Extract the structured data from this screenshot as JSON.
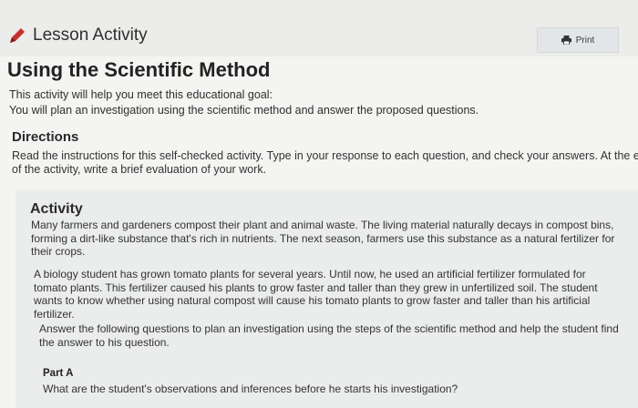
{
  "header": {
    "lesson_label": "Lesson Activity",
    "print_label": "Print",
    "pencil_color": "#c8312b"
  },
  "page": {
    "title": "Using the Scientific Method",
    "intro_lines": [
      "This activity will help you meet this educational goal:",
      "You will plan an investigation using the scientific method and answer the proposed questions."
    ]
  },
  "directions": {
    "heading": "Directions",
    "lines": [
      "Read the instructions for this self-checked activity. Type in your response to each question, and check your answers. At the en",
      "of the activity, write a brief evaluation of your work."
    ]
  },
  "activity": {
    "heading": "Activity",
    "paragraph1": [
      "Many farmers and gardeners compost their plant and animal waste. The living material naturally decays in compost bins,",
      "forming a dirt-like substance that's rich in nutrients. The next season, farmers use this substance as a natural fertilizer for",
      "their crops."
    ],
    "paragraph2": [
      "A biology student has grown tomato plants for several years. Until now, he used an artificial fertilizer formulated for",
      "tomato plants. This fertilizer caused his plants to grow faster and taller than they grew in unfertilized soil. The student",
      "wants to know whether using natural compost will cause his tomato plants to grow faster and taller than his artificial",
      "fertilizer."
    ],
    "paragraph3": [
      "Answer the following questions to plan an investigation using the steps of the scientific method and help the student find",
      "the answer to his question."
    ],
    "part_a_label": "Part A",
    "part_a_question": "What are the student's observations and inferences before he starts his investigation?"
  }
}
